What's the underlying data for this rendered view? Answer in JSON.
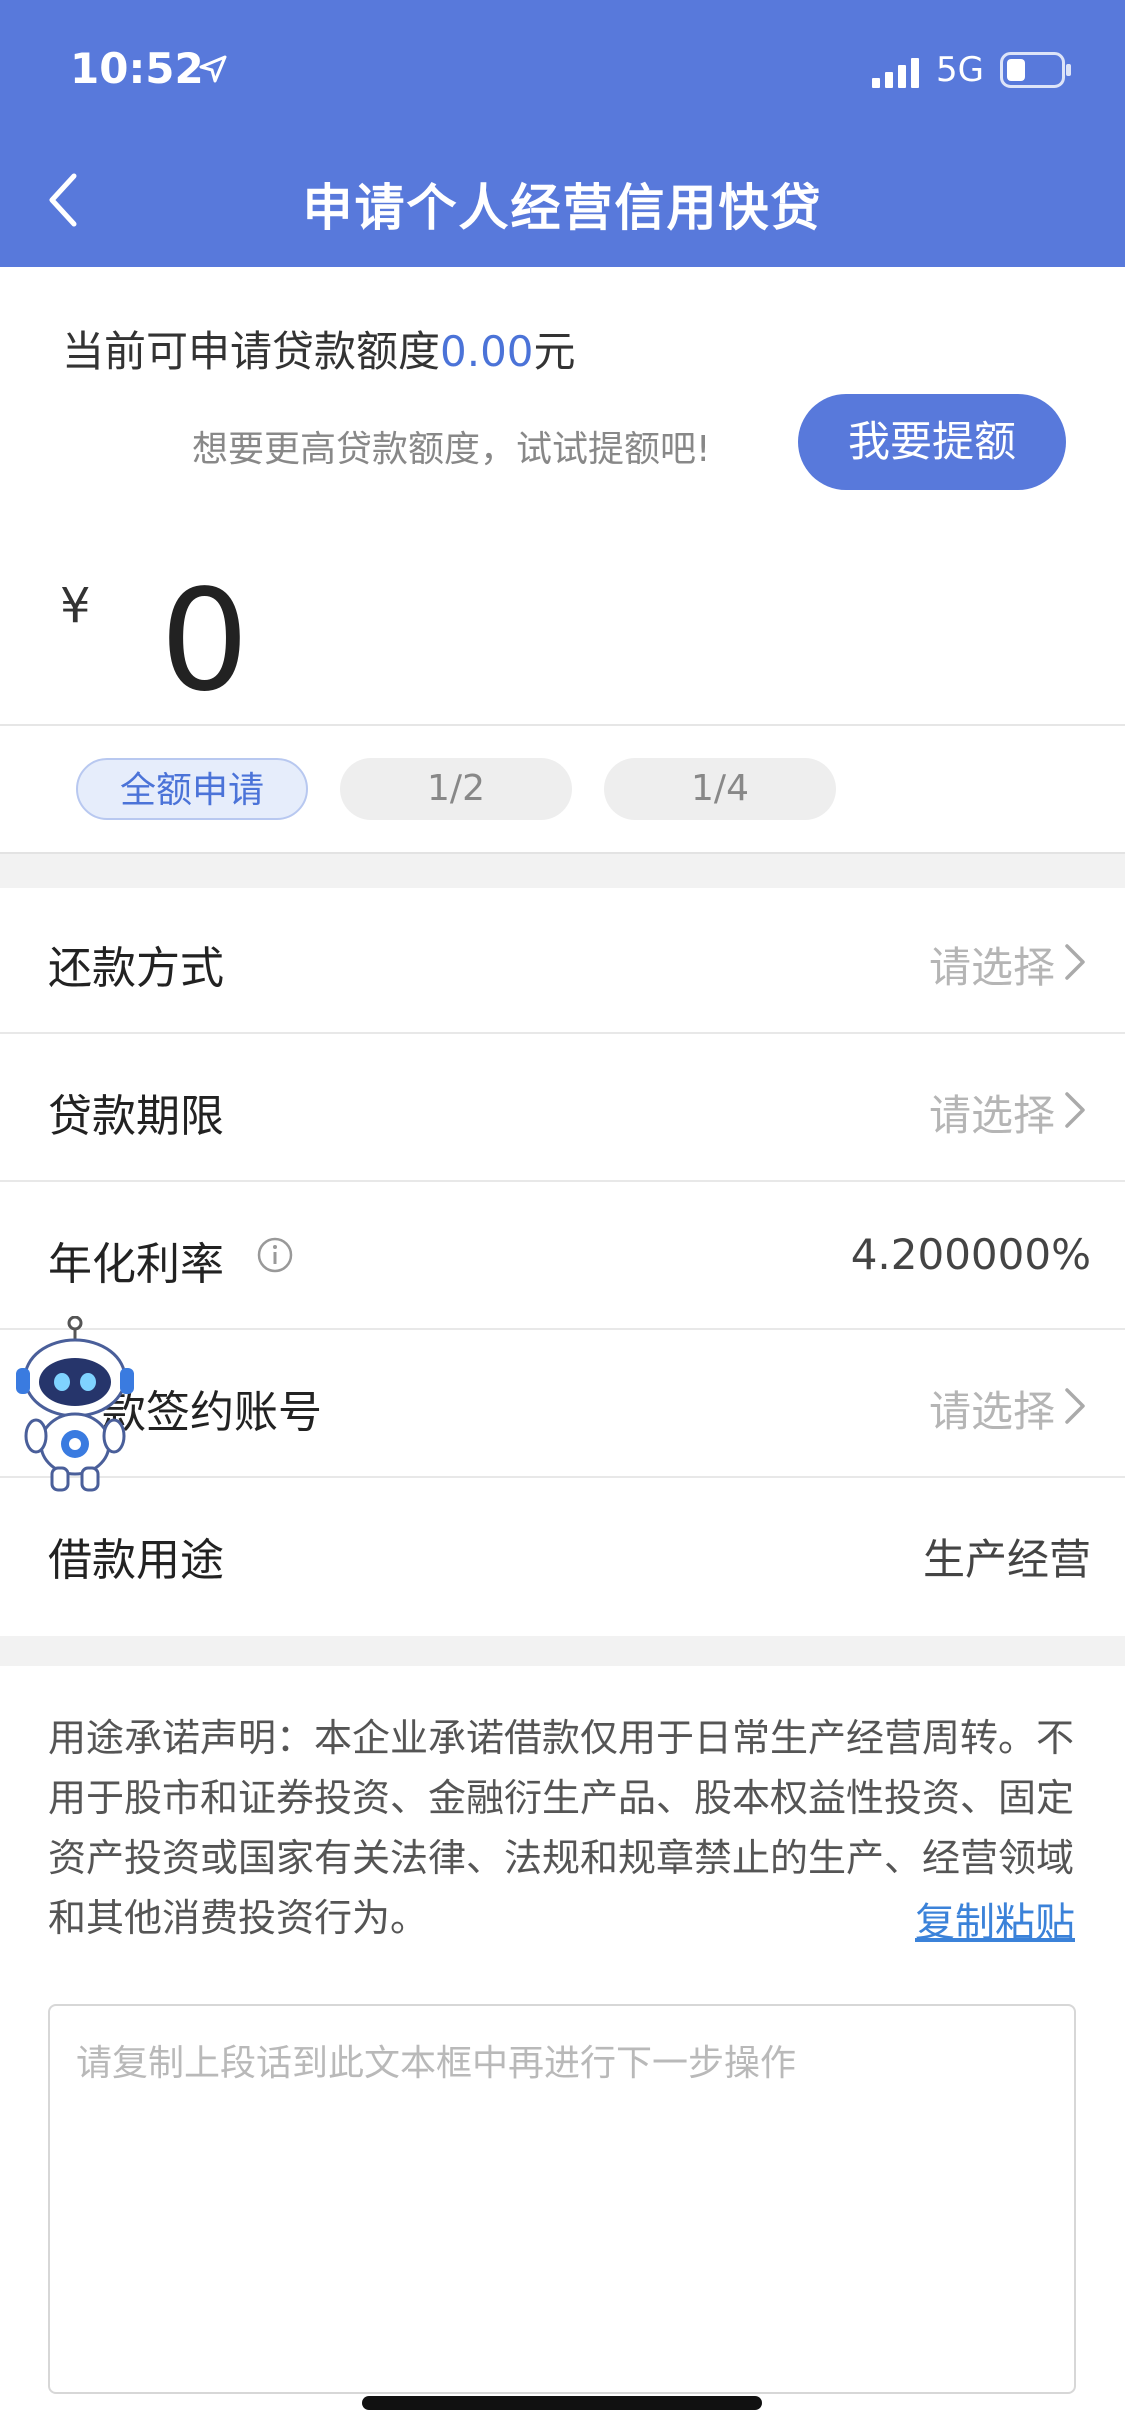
{
  "status_bar": {
    "time": "10:52",
    "network": "5G"
  },
  "header": {
    "title": "申请个人经营信用快贷"
  },
  "quota": {
    "prefix": "当前可申请贷款额度",
    "amount": "0.00",
    "unit": "元"
  },
  "raise": {
    "hint": "想要更高贷款额度，试试提额吧!",
    "button_label": "我要提额"
  },
  "amount": {
    "currency": "¥",
    "value": "0"
  },
  "quick_options": [
    {
      "label": "全额申请",
      "selected": true
    },
    {
      "label": "1/2",
      "selected": false
    },
    {
      "label": "1/4",
      "selected": false
    }
  ],
  "form_rows": [
    {
      "label": "还款方式",
      "value": "请选择"
    },
    {
      "label": "贷款期限",
      "value": "请选择"
    },
    {
      "label": "年化利率",
      "value": "4.200000%"
    },
    {
      "label": "款签约账号",
      "value": "请选择"
    },
    {
      "label": "借款用途",
      "value": "生产经营"
    }
  ],
  "statement": {
    "text": "用途承诺声明：本企业承诺借款仅用于日常生产经营周转。不用于股市和证券投资、金融衍生产品、股本权益性投资、固定资产投资或国家有关法律、法规和规章禁止的生产、经营领域和其他消费投资行为。",
    "copy_label": "复制粘贴"
  },
  "input": {
    "placeholder": "请复制上段话到此文本框中再进行下一步操作"
  },
  "colors": {
    "brand": "#5879db",
    "accent_text": "#4b73d8",
    "link": "#3b82d9"
  }
}
